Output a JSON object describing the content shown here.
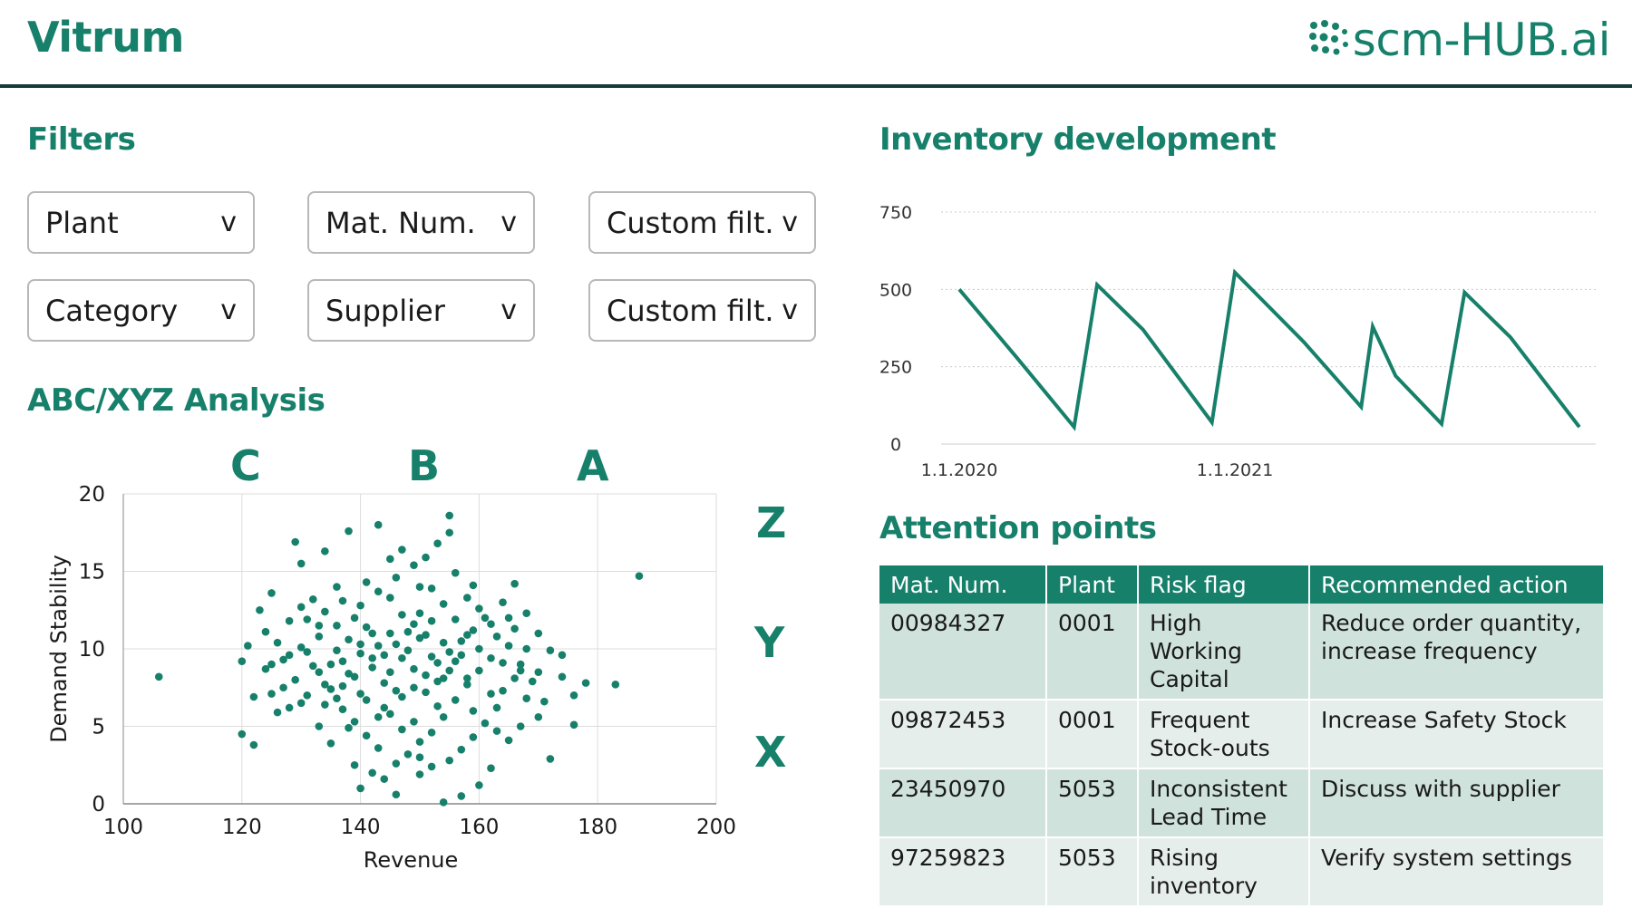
{
  "app": {
    "title": "Vitrum",
    "brand": "scm-HUB.ai"
  },
  "sections": {
    "filters": "Filters",
    "abc": "ABC/XYZ Analysis",
    "inventory": "Inventory development",
    "attention": "Attention points"
  },
  "filters": [
    {
      "label": "Plant",
      "chevron": "v"
    },
    {
      "label": "Mat. Num.",
      "chevron": "v"
    },
    {
      "label": "Custom filt.",
      "chevron": "v"
    },
    {
      "label": "Category",
      "chevron": "v"
    },
    {
      "label": "Supplier",
      "chevron": "v"
    },
    {
      "label": "Custom filt.",
      "chevron": "v"
    }
  ],
  "abc_letters": [
    "C",
    "B",
    "A"
  ],
  "xyz_letters": [
    "Z",
    "Y",
    "X"
  ],
  "colors": {
    "accent": "#17806b",
    "header_rule": "#163c3a",
    "row_odd": "#cfe2dc",
    "row_even": "#e6eeeb"
  },
  "chart_data": [
    {
      "type": "scatter",
      "xlabel": "Revenue",
      "ylabel": "Demand Stability",
      "xlim": [
        100,
        200
      ],
      "ylim": [
        0,
        20
      ],
      "xticks": [
        100,
        120,
        140,
        160,
        180,
        200
      ],
      "yticks": [
        0,
        5,
        10,
        15,
        20
      ],
      "grid": true,
      "points": [
        [
          106,
          8.2
        ],
        [
          187,
          14.7
        ],
        [
          183,
          7.7
        ],
        [
          178,
          7.8
        ],
        [
          176,
          5.1
        ],
        [
          174,
          9.6
        ],
        [
          172,
          2.9
        ],
        [
          120,
          4.5
        ],
        [
          122,
          3.8
        ],
        [
          120,
          9.2
        ],
        [
          123,
          12.5
        ],
        [
          125,
          13.6
        ],
        [
          134,
          16.3
        ],
        [
          138,
          17.6
        ],
        [
          143,
          18.0
        ],
        [
          155,
          18.6
        ],
        [
          155,
          17.5
        ],
        [
          159,
          14.1
        ],
        [
          166,
          14.2
        ],
        [
          157,
          0.5
        ],
        [
          154,
          0.1
        ],
        [
          146,
          0.6
        ],
        [
          140,
          1.0
        ],
        [
          162,
          2.3
        ],
        [
          142,
          2.0
        ],
        [
          150,
          3.0
        ],
        [
          160,
          1.2
        ],
        [
          129,
          16.9
        ],
        [
          130,
          15.5
        ],
        [
          136,
          14.0
        ],
        [
          164,
          13.0
        ],
        [
          168,
          12.3
        ],
        [
          170,
          11.0
        ],
        [
          168,
          6.8
        ],
        [
          165,
          4.1
        ],
        [
          133,
          5.0
        ],
        [
          128,
          6.2
        ],
        [
          125,
          7.1
        ],
        [
          124,
          8.7
        ],
        [
          126,
          10.4
        ],
        [
          128,
          11.8
        ],
        [
          131,
          9.8
        ],
        [
          133,
          8.5
        ],
        [
          135,
          7.4
        ],
        [
          137,
          6.1
        ],
        [
          139,
          5.3
        ],
        [
          141,
          4.4
        ],
        [
          143,
          3.6
        ],
        [
          145,
          5.8
        ],
        [
          147,
          6.9
        ],
        [
          149,
          7.5
        ],
        [
          151,
          8.3
        ],
        [
          153,
          9.1
        ],
        [
          155,
          9.8
        ],
        [
          157,
          10.5
        ],
        [
          159,
          11.2
        ],
        [
          161,
          12.0
        ],
        [
          163,
          10.8
        ],
        [
          162,
          9.4
        ],
        [
          160,
          8.6
        ],
        [
          158,
          7.7
        ],
        [
          156,
          6.7
        ],
        [
          154,
          5.6
        ],
        [
          152,
          4.6
        ],
        [
          150,
          4.0
        ],
        [
          148,
          3.2
        ],
        [
          146,
          2.6
        ],
        [
          144,
          7.8
        ],
        [
          142,
          8.8
        ],
        [
          140,
          9.7
        ],
        [
          138,
          10.6
        ],
        [
          136,
          11.5
        ],
        [
          134,
          12.4
        ],
        [
          132,
          13.2
        ],
        [
          130,
          10.1
        ],
        [
          129,
          8.0
        ],
        [
          131,
          7.0
        ],
        [
          134,
          6.4
        ],
        [
          137,
          9.2
        ],
        [
          140,
          12.8
        ],
        [
          143,
          13.7
        ],
        [
          146,
          14.6
        ],
        [
          149,
          15.4
        ],
        [
          152,
          13.9
        ],
        [
          154,
          12.9
        ],
        [
          156,
          11.9
        ],
        [
          158,
          13.3
        ],
        [
          160,
          12.6
        ],
        [
          162,
          11.6
        ],
        [
          165,
          10.2
        ],
        [
          167,
          9.0
        ],
        [
          169,
          7.9
        ],
        [
          171,
          6.6
        ],
        [
          166,
          8.1
        ],
        [
          164,
          7.3
        ],
        [
          163,
          6.2
        ],
        [
          161,
          5.2
        ],
        [
          159,
          4.3
        ],
        [
          157,
          3.5
        ],
        [
          155,
          2.8
        ],
        [
          153,
          6.3
        ],
        [
          151,
          10.9
        ],
        [
          149,
          11.6
        ],
        [
          147,
          12.2
        ],
        [
          145,
          11.0
        ],
        [
          143,
          10.2
        ],
        [
          141,
          11.4
        ],
        [
          139,
          8.2
        ],
        [
          137,
          7.6
        ],
        [
          135,
          9.0
        ],
        [
          133,
          10.8
        ],
        [
          131,
          11.9
        ],
        [
          127,
          9.3
        ],
        [
          126,
          5.9
        ],
        [
          122,
          6.9
        ],
        [
          121,
          10.2
        ],
        [
          124,
          11.1
        ],
        [
          135,
          3.9
        ],
        [
          138,
          4.9
        ],
        [
          144,
          6.2
        ],
        [
          148,
          9.9
        ],
        [
          150,
          10.7
        ],
        [
          152,
          11.8
        ],
        [
          154,
          10.4
        ],
        [
          156,
          9.2
        ],
        [
          158,
          8.1
        ],
        [
          145,
          8.5
        ],
        [
          147,
          9.4
        ],
        [
          149,
          8.7
        ],
        [
          151,
          7.2
        ],
        [
          153,
          7.9
        ],
        [
          155,
          8.6
        ],
        [
          157,
          9.6
        ],
        [
          146,
          10.3
        ],
        [
          148,
          11.1
        ],
        [
          150,
          12.3
        ],
        [
          152,
          9.5
        ],
        [
          154,
          8.1
        ],
        [
          142,
          9.4
        ],
        [
          140,
          7.1
        ],
        [
          138,
          8.4
        ],
        [
          136,
          6.8
        ],
        [
          134,
          7.7
        ],
        [
          132,
          8.9
        ],
        [
          130,
          6.5
        ],
        [
          128,
          9.6
        ],
        [
          160,
          10.0
        ],
        [
          162,
          7.1
        ],
        [
          164,
          9.1
        ],
        [
          166,
          11.3
        ],
        [
          168,
          10.0
        ],
        [
          170,
          8.5
        ],
        [
          172,
          9.9
        ],
        [
          174,
          8.2
        ],
        [
          176,
          7.0
        ],
        [
          170,
          5.6
        ],
        [
          167,
          5.0
        ],
        [
          163,
          4.7
        ],
        [
          159,
          6.0
        ],
        [
          147,
          4.8
        ],
        [
          143,
          5.6
        ],
        [
          141,
          6.7
        ],
        [
          139,
          12.0
        ],
        [
          137,
          13.1
        ],
        [
          141,
          14.3
        ],
        [
          145,
          13.3
        ],
        [
          150,
          14.0
        ],
        [
          156,
          14.9
        ],
        [
          158,
          10.9
        ],
        [
          165,
          12.0
        ],
        [
          167,
          8.6
        ],
        [
          139,
          2.5
        ],
        [
          144,
          1.6
        ],
        [
          150,
          1.9
        ],
        [
          152,
          2.4
        ],
        [
          149,
          5.3
        ],
        [
          146,
          7.3
        ],
        [
          144,
          9.6
        ],
        [
          142,
          11.0
        ],
        [
          140,
          10.3
        ],
        [
          136,
          9.9
        ],
        [
          133,
          11.5
        ],
        [
          130,
          12.7
        ],
        [
          127,
          7.5
        ],
        [
          125,
          9.0
        ],
        [
          147,
          16.4
        ],
        [
          151,
          15.9
        ],
        [
          153,
          16.8
        ],
        [
          145,
          15.8
        ]
      ]
    },
    {
      "type": "line",
      "x": [
        "1.1.2020",
        "",
        "",
        "",
        "",
        "",
        "",
        "",
        "",
        "",
        "",
        "",
        "1.1.2021",
        "",
        "",
        "",
        "",
        "",
        ""
      ],
      "xticks": [
        "1.1.2020",
        "1.1.2021"
      ],
      "ylim": [
        0,
        750
      ],
      "yticks": [
        0,
        250,
        500,
        750
      ],
      "grid": true,
      "values": [
        500,
        280,
        55,
        515,
        370,
        70,
        555,
        330,
        120,
        380,
        220,
        65,
        490,
        345,
        55
      ],
      "x_positions_months": [
        0,
        2.5,
        5,
        6,
        8,
        11,
        12,
        15,
        17.5,
        18,
        19,
        21,
        22,
        24,
        27
      ]
    }
  ],
  "attention": {
    "columns": [
      "Mat. Num.",
      "Plant",
      "Risk flag",
      "Recommended action"
    ],
    "rows": [
      {
        "mat": "00984327",
        "plant": "0001",
        "risk": "High Working Capital",
        "action": "Reduce order quantity, increase frequency"
      },
      {
        "mat": "09872453",
        "plant": "0001",
        "risk": "Frequent Stock-outs",
        "action": "Increase Safety Stock"
      },
      {
        "mat": "23450970",
        "plant": "5053",
        "risk": "Inconsistent Lead Time",
        "action": "Discuss with supplier"
      },
      {
        "mat": "97259823",
        "plant": "5053",
        "risk": "Rising inventory",
        "action": "Verify system settings"
      }
    ]
  }
}
